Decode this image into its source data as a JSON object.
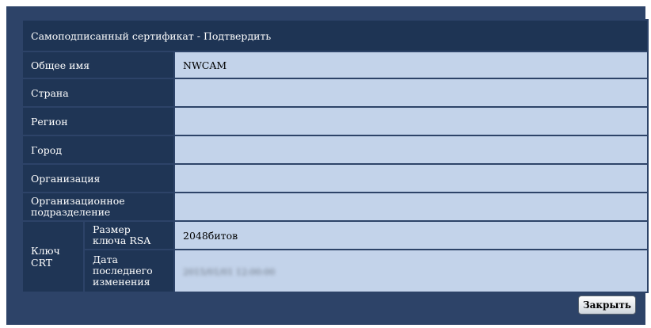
{
  "dialog": {
    "title": "Самоподписанный сертификат - Подтвердить",
    "close_label": "Закрыть"
  },
  "fields": {
    "common_name": {
      "label": "Общее имя",
      "value": "NWCAM"
    },
    "country": {
      "label": "Страна",
      "value": ""
    },
    "region": {
      "label": "Регион",
      "value": ""
    },
    "city": {
      "label": "Город",
      "value": ""
    },
    "organization": {
      "label": "Организация",
      "value": ""
    },
    "org_unit": {
      "label": "Организационное подразделение",
      "value": ""
    }
  },
  "crt_key": {
    "group_label": "Ключ CRT",
    "key_size": {
      "label": "Размер ключа RSA",
      "value": "2048битов"
    },
    "last_modified": {
      "label": "Дата последнего изменения",
      "value": "2015/01/01 12:00:00"
    }
  }
}
